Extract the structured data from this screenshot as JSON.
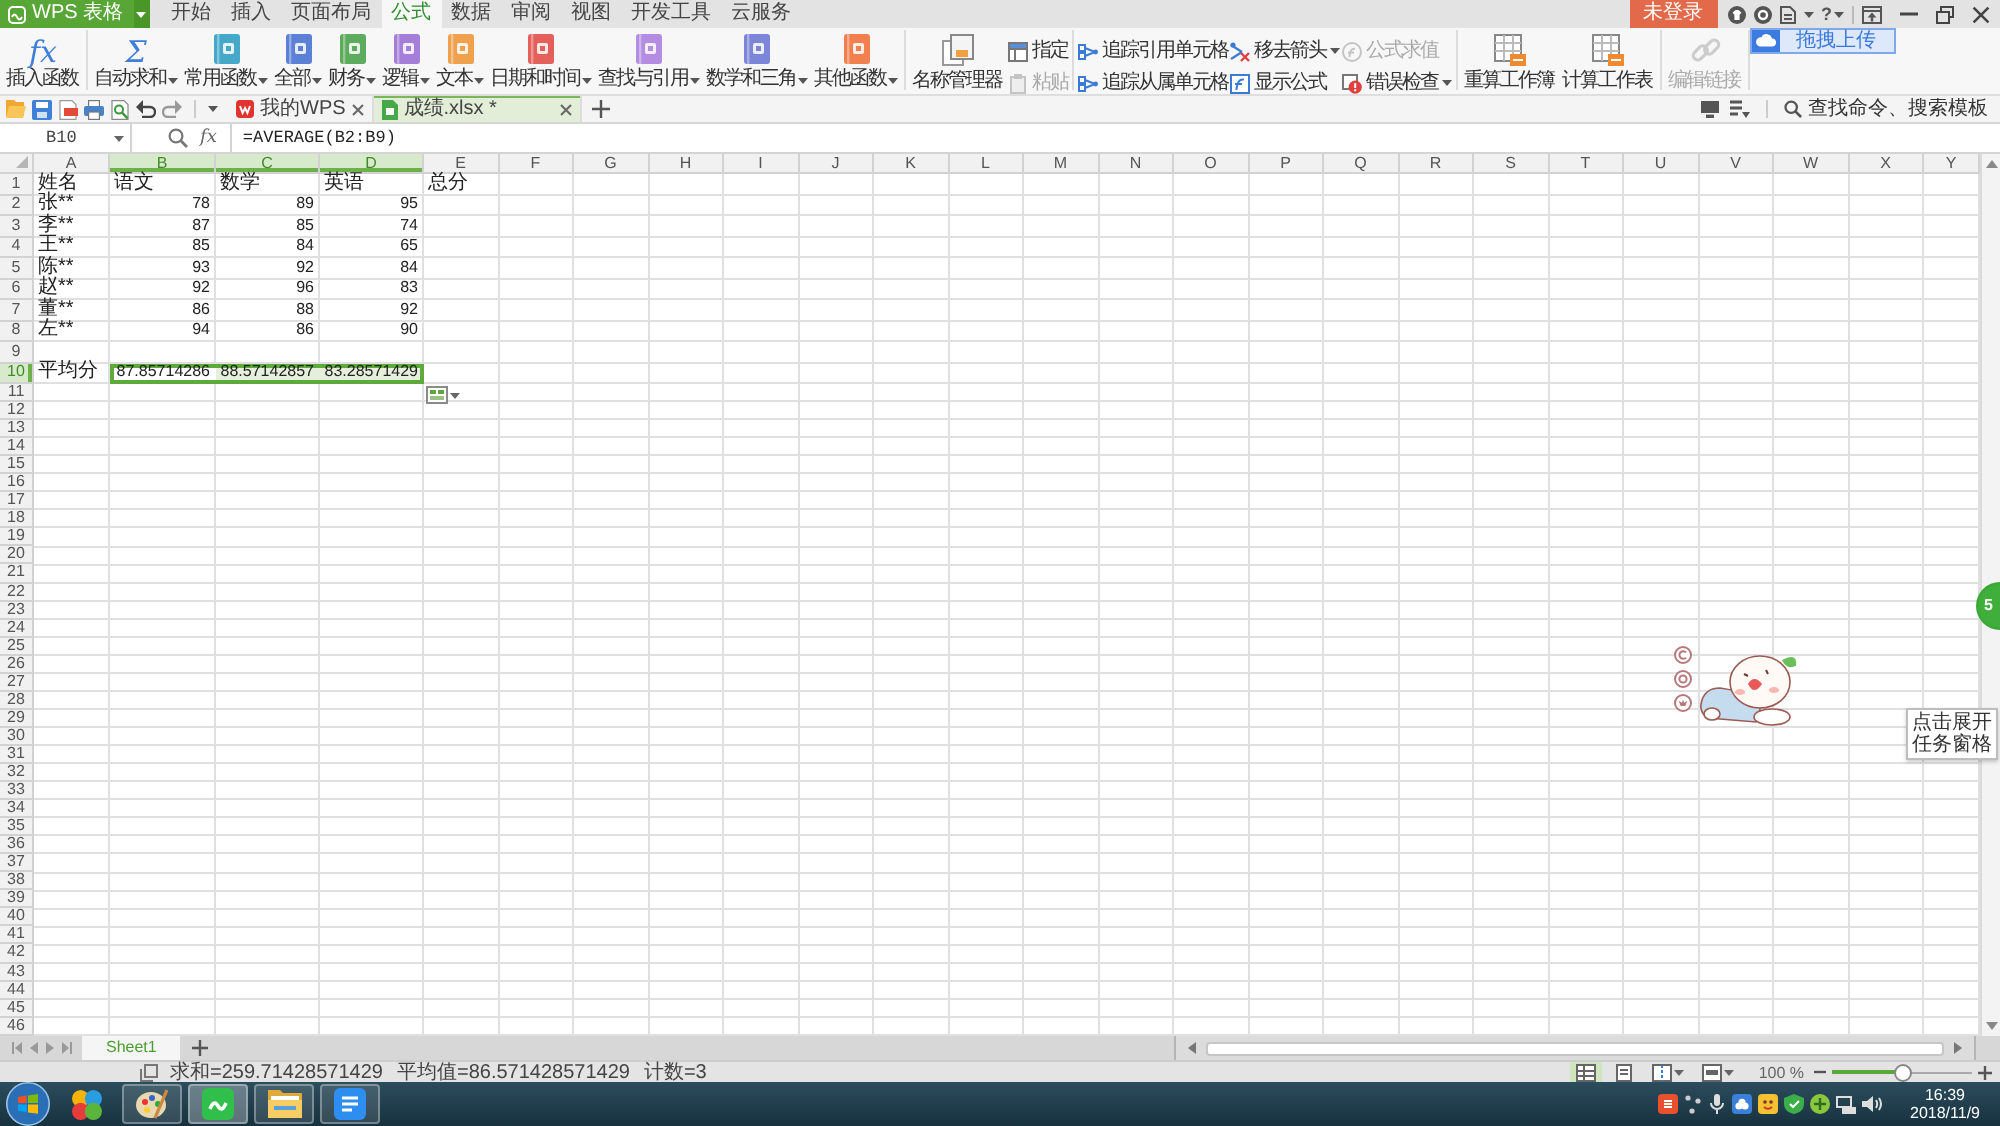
{
  "app_bar": {
    "app_name": "WPS 表格",
    "tabs": [
      {
        "label": "开始",
        "selected": false
      },
      {
        "label": "插入",
        "selected": false
      },
      {
        "label": "页面布局",
        "selected": false
      },
      {
        "label": "公式",
        "selected": true
      },
      {
        "label": "数据",
        "selected": false
      },
      {
        "label": "审阅",
        "selected": false
      },
      {
        "label": "视图",
        "selected": false
      },
      {
        "label": "开发工具",
        "selected": false
      },
      {
        "label": "云服务",
        "selected": false
      }
    ],
    "login": "未登录",
    "help": "?"
  },
  "ribbon": {
    "groups": [
      {
        "items": [
          {
            "kind": "large",
            "symbol": "fx",
            "label": "插入函数",
            "menu": false,
            "disabled": false
          }
        ]
      },
      {
        "items": [
          {
            "kind": "large",
            "symbol": "Σ",
            "label": "自动求和",
            "menu": true,
            "disabled": false
          },
          {
            "kind": "large",
            "label": "常用函数",
            "menu": true,
            "disabled": false
          },
          {
            "kind": "large",
            "label": "全部",
            "menu": true,
            "disabled": false
          },
          {
            "kind": "large",
            "label": "财务",
            "menu": true,
            "disabled": false
          },
          {
            "kind": "large",
            "label": "逻辑",
            "menu": true,
            "disabled": false
          },
          {
            "kind": "large",
            "label": "文本",
            "menu": true,
            "disabled": false
          },
          {
            "kind": "large",
            "label": "日期和时间",
            "menu": true,
            "disabled": false
          },
          {
            "kind": "large",
            "label": "查找与引用",
            "menu": true,
            "disabled": false
          },
          {
            "kind": "large",
            "label": "数学和三角",
            "menu": true,
            "disabled": false
          },
          {
            "kind": "large",
            "label": "其他函数",
            "menu": true,
            "disabled": false
          }
        ]
      },
      {
        "items": [
          {
            "kind": "large",
            "label": "名称管理器",
            "menu": false,
            "disabled": false
          },
          {
            "kind": "stack",
            "buttons": [
              {
                "label": "指定",
                "menu": false,
                "disabled": false
              },
              {
                "label": "粘贴",
                "menu": false,
                "disabled": true
              }
            ]
          }
        ]
      },
      {
        "items": [
          {
            "kind": "stack",
            "buttons": [
              {
                "label": "追踪引用单元格",
                "menu": false,
                "disabled": false
              },
              {
                "label": "追踪从属单元格",
                "menu": false,
                "disabled": false
              }
            ]
          },
          {
            "kind": "stack",
            "buttons": [
              {
                "label": "移去箭头",
                "menu": true,
                "disabled": false
              },
              {
                "label": "显示公式",
                "menu": false,
                "disabled": false
              }
            ]
          },
          {
            "kind": "stack",
            "buttons": [
              {
                "label": "公式求值",
                "menu": false,
                "disabled": true
              },
              {
                "label": "错误检查",
                "menu": true,
                "disabled": false
              }
            ]
          }
        ]
      },
      {
        "items": [
          {
            "kind": "large",
            "label": "重算工作簿",
            "menu": false,
            "disabled": false
          },
          {
            "kind": "large",
            "label": "计算工作表",
            "menu": false,
            "disabled": false
          }
        ]
      },
      {
        "items": [
          {
            "kind": "large",
            "label": "编辑链接",
            "menu": false,
            "disabled": true
          }
        ]
      }
    ],
    "upload_button": "拖拽上传"
  },
  "doc_bar": {
    "tabs": [
      {
        "label": "我的WPS",
        "selected": false
      },
      {
        "label": "成绩.xlsx *",
        "selected": true
      }
    ],
    "search": {
      "placeholder": "查找命令、搜索模板"
    }
  },
  "formula_bar": {
    "cell_name": "B10",
    "fx": "fx",
    "formula": "=AVERAGE(B2:B9)"
  },
  "sheet": {
    "columns": [
      {
        "label": "A",
        "selected": false
      },
      {
        "label": "B",
        "selected": true
      },
      {
        "label": "C",
        "selected": true
      },
      {
        "label": "D",
        "selected": true
      },
      {
        "label": "E",
        "selected": false
      },
      {
        "label": "F",
        "selected": false
      },
      {
        "label": "G",
        "selected": false
      },
      {
        "label": "H",
        "selected": false
      },
      {
        "label": "I",
        "selected": false
      },
      {
        "label": "J",
        "selected": false
      },
      {
        "label": "K",
        "selected": false
      },
      {
        "label": "L",
        "selected": false
      },
      {
        "label": "M",
        "selected": false
      },
      {
        "label": "N",
        "selected": false
      },
      {
        "label": "O",
        "selected": false
      },
      {
        "label": "P",
        "selected": false
      },
      {
        "label": "Q",
        "selected": false
      },
      {
        "label": "R",
        "selected": false
      },
      {
        "label": "S",
        "selected": false
      },
      {
        "label": "T",
        "selected": false
      },
      {
        "label": "U",
        "selected": false
      },
      {
        "label": "V",
        "selected": false
      },
      {
        "label": "W",
        "selected": false
      },
      {
        "label": "X",
        "selected": false
      },
      {
        "label": "Y",
        "selected": false
      }
    ],
    "rows": [
      {
        "header": "1",
        "selected": false,
        "cells": [
          {
            "text": "姓名",
            "kind": "text",
            "selected": false,
            "active": false
          },
          {
            "text": "语文",
            "kind": "text",
            "selected": false,
            "active": false
          },
          {
            "text": "数学",
            "kind": "text",
            "selected": false,
            "active": false
          },
          {
            "text": "英语",
            "kind": "text",
            "selected": false,
            "active": false
          },
          {
            "text": "总分",
            "kind": "text",
            "selected": false,
            "active": false
          }
        ]
      },
      {
        "header": "2",
        "selected": false,
        "cells": [
          {
            "text": "张**",
            "kind": "text",
            "selected": false,
            "active": false
          },
          {
            "text": "78",
            "kind": "number",
            "selected": false,
            "active": false
          },
          {
            "text": "89",
            "kind": "number",
            "selected": false,
            "active": false
          },
          {
            "text": "95",
            "kind": "number",
            "selected": false,
            "active": false
          }
        ]
      },
      {
        "header": "3",
        "selected": false,
        "cells": [
          {
            "text": "李**",
            "kind": "text",
            "selected": false,
            "active": false
          },
          {
            "text": "87",
            "kind": "number",
            "selected": false,
            "active": false
          },
          {
            "text": "85",
            "kind": "number",
            "selected": false,
            "active": false
          },
          {
            "text": "74",
            "kind": "number",
            "selected": false,
            "active": false
          }
        ]
      },
      {
        "header": "4",
        "selected": false,
        "cells": [
          {
            "text": "王**",
            "kind": "text",
            "selected": false,
            "active": false
          },
          {
            "text": "85",
            "kind": "number",
            "selected": false,
            "active": false
          },
          {
            "text": "84",
            "kind": "number",
            "selected": false,
            "active": false
          },
          {
            "text": "65",
            "kind": "number",
            "selected": false,
            "active": false
          }
        ]
      },
      {
        "header": "5",
        "selected": false,
        "cells": [
          {
            "text": "陈**",
            "kind": "text",
            "selected": false,
            "active": false
          },
          {
            "text": "93",
            "kind": "number",
            "selected": false,
            "active": false
          },
          {
            "text": "92",
            "kind": "number",
            "selected": false,
            "active": false
          },
          {
            "text": "84",
            "kind": "number",
            "selected": false,
            "active": false
          }
        ]
      },
      {
        "header": "6",
        "selected": false,
        "cells": [
          {
            "text": "赵**",
            "kind": "text",
            "selected": false,
            "active": false
          },
          {
            "text": "92",
            "kind": "number",
            "selected": false,
            "active": false
          },
          {
            "text": "96",
            "kind": "number",
            "selected": false,
            "active": false
          },
          {
            "text": "83",
            "kind": "number",
            "selected": false,
            "active": false
          }
        ]
      },
      {
        "header": "7",
        "selected": false,
        "cells": [
          {
            "text": "董**",
            "kind": "text",
            "selected": false,
            "active": false
          },
          {
            "text": "86",
            "kind": "number",
            "selected": false,
            "active": false
          },
          {
            "text": "88",
            "kind": "number",
            "selected": false,
            "active": false
          },
          {
            "text": "92",
            "kind": "number",
            "selected": false,
            "active": false
          }
        ]
      },
      {
        "header": "8",
        "selected": false,
        "cells": [
          {
            "text": "左**",
            "kind": "text",
            "selected": false,
            "active": false
          },
          {
            "text": "94",
            "kind": "number",
            "selected": false,
            "active": false
          },
          {
            "text": "86",
            "kind": "number",
            "selected": false,
            "active": false
          },
          {
            "text": "90",
            "kind": "number",
            "selected": false,
            "active": false
          }
        ]
      },
      {
        "header": "9",
        "selected": false
      },
      {
        "header": "10",
        "selected": true,
        "cells": [
          {
            "text": "平均分",
            "kind": "text",
            "selected": false,
            "active": false
          },
          {
            "text": "87.85714286",
            "kind": "number",
            "selected": true,
            "active": true
          },
          {
            "text": "88.57142857",
            "kind": "number",
            "selected": true,
            "active": false
          },
          {
            "text": "83.28571429",
            "kind": "number",
            "selected": true,
            "active": false
          }
        ]
      },
      {
        "header": "11",
        "selected": false
      },
      {
        "header": "12",
        "selected": false
      },
      {
        "header": "13",
        "selected": false
      },
      {
        "header": "14",
        "selected": false
      },
      {
        "header": "15",
        "selected": false
      },
      {
        "header": "16",
        "selected": false
      },
      {
        "header": "17",
        "selected": false
      },
      {
        "header": "18",
        "selected": false
      },
      {
        "header": "19",
        "selected": false
      },
      {
        "header": "20",
        "selected": false
      },
      {
        "header": "21",
        "selected": false
      },
      {
        "header": "22",
        "selected": false
      },
      {
        "header": "23",
        "selected": false
      },
      {
        "header": "24",
        "selected": false
      },
      {
        "header": "25",
        "selected": false
      },
      {
        "header": "26",
        "selected": false
      },
      {
        "header": "27",
        "selected": false
      },
      {
        "header": "28",
        "selected": false
      },
      {
        "header": "29",
        "selected": false
      },
      {
        "header": "30",
        "selected": false
      },
      {
        "header": "31",
        "selected": false
      },
      {
        "header": "32",
        "selected": false
      },
      {
        "header": "33",
        "selected": false
      },
      {
        "header": "34",
        "selected": false
      },
      {
        "header": "35",
        "selected": false
      },
      {
        "header": "36",
        "selected": false
      },
      {
        "header": "37",
        "selected": false
      },
      {
        "header": "38",
        "selected": false
      },
      {
        "header": "39",
        "selected": false
      },
      {
        "header": "40",
        "selected": false
      },
      {
        "header": "41",
        "selected": false
      },
      {
        "header": "42",
        "selected": false
      },
      {
        "header": "43",
        "selected": false
      },
      {
        "header": "44",
        "selected": false
      },
      {
        "header": "45",
        "selected": false
      },
      {
        "header": "46",
        "selected": false
      }
    ]
  },
  "overlays": {
    "float_ball": "5",
    "tooltip": "点击展开任务窗格"
  },
  "sheet_tabs": {
    "tabs": [
      {
        "label": "Sheet1",
        "selected": true
      }
    ]
  },
  "status_bar": {
    "stats": [
      "求和=259.71428571429",
      "平均值=86.571428571429",
      "计数=3"
    ],
    "views": [
      {
        "selected": true,
        "menu": false
      },
      {
        "selected": false,
        "menu": false
      },
      {
        "selected": false,
        "menu": true
      },
      {
        "selected": false,
        "menu": true
      }
    ],
    "zoom_label": "100 %",
    "zoom": {
      "level": 0.5
    }
  },
  "taskbar": {
    "apps": [
      {
        "running": false,
        "active": false
      },
      {
        "running": true,
        "active": false
      },
      {
        "running": true,
        "active": true
      },
      {
        "running": true,
        "active": false
      },
      {
        "running": true,
        "active": false
      }
    ],
    "time": "16:39",
    "date": "2018/11/9"
  }
}
